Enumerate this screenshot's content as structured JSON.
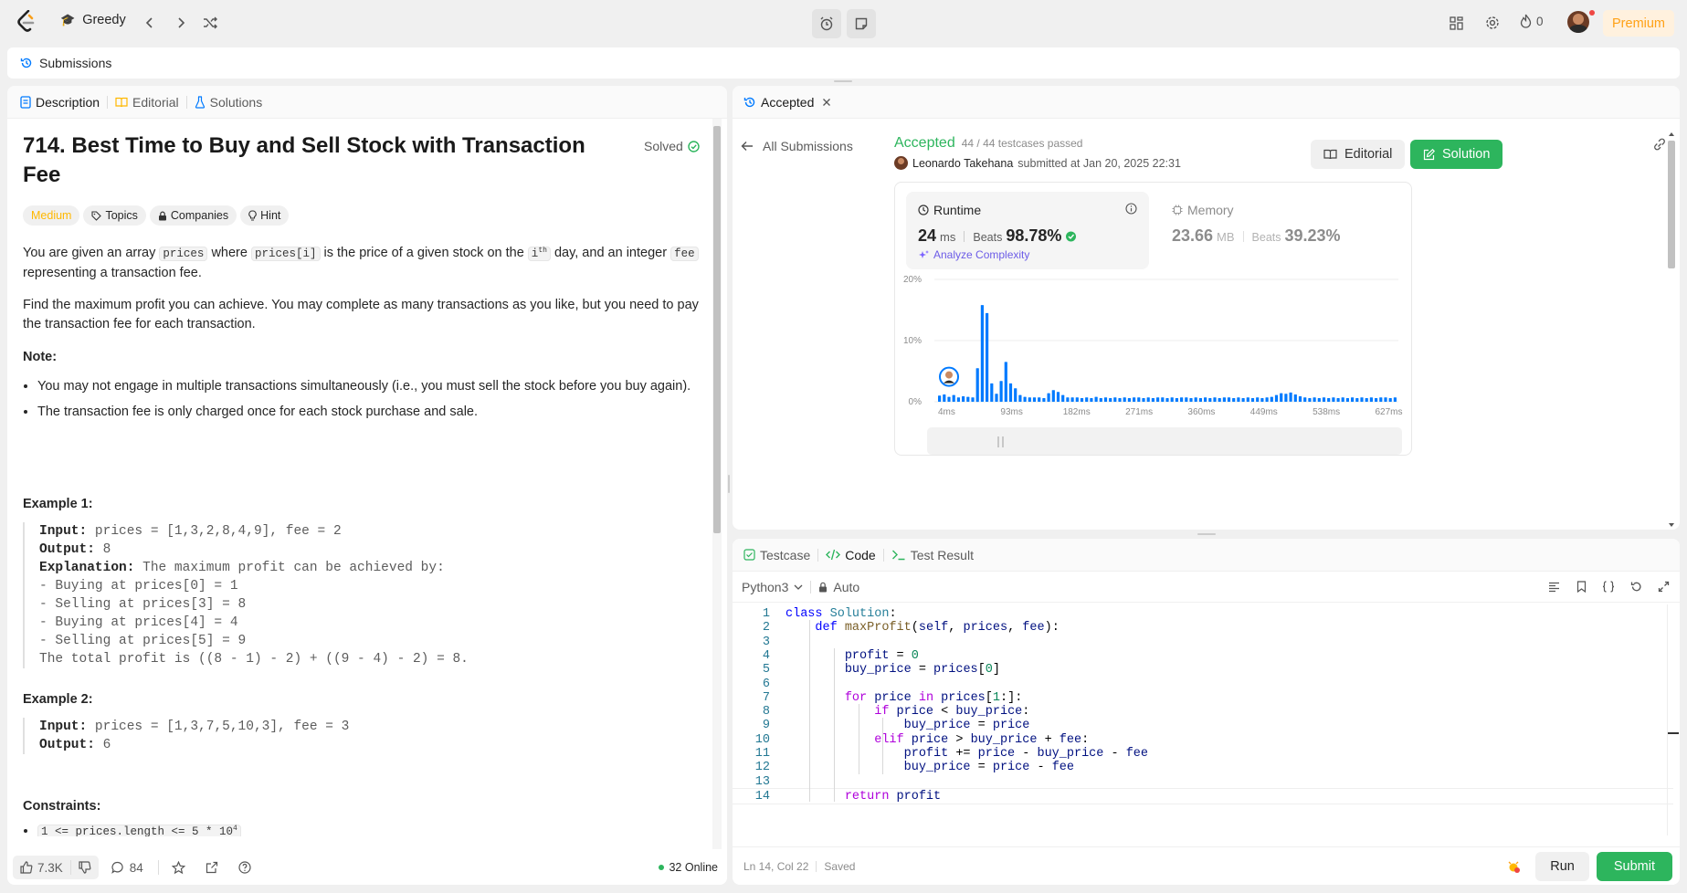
{
  "topbar": {
    "problem_list_label": "Greedy",
    "streak_count": "0",
    "premium_label": "Premium"
  },
  "subbar": {
    "label": "Submissions"
  },
  "left": {
    "tabs": [
      "Description",
      "Editorial",
      "Solutions"
    ],
    "title_line1": "714. Best Time to Buy and Sell Stock with Transaction",
    "title_line2": "Fee",
    "solved_label": "Solved",
    "chips": {
      "difficulty": "Medium",
      "topics": "Topics",
      "companies": "Companies",
      "hint": "Hint"
    },
    "para1": {
      "t1": "You are given an array ",
      "c1": "prices",
      "t2": " where ",
      "c2": "prices[i]",
      "t3": " is the price of a given stock on the ",
      "c3": "i",
      "c3sup": "th",
      "t4": " day, and an integer ",
      "c4": "fee",
      "t5": "representing a transaction fee."
    },
    "para2": "Find the maximum profit you can achieve. You may complete as many transactions as you like, but you need to pay the transaction fee for each transaction.",
    "note_label": "Note:",
    "notes": [
      "You may not engage in multiple transactions simultaneously (i.e., you must sell the stock before you buy again).",
      "The transaction fee is only charged once for each stock purchase and sale."
    ],
    "example1": {
      "heading": "Example 1:",
      "input_label": "Input:",
      "input": " prices = [1,3,2,8,4,9], fee = 2",
      "output_label": "Output:",
      "output": " 8",
      "explanation_label": "Explanation:",
      "explanation": " The maximum profit can be achieved by:",
      "steps": [
        "- Buying at prices[0] = 1",
        "- Selling at prices[3] = 8",
        "- Buying at prices[4] = 4",
        "- Selling at prices[5] = 9"
      ],
      "total": "The total profit is ((8 - 1) - 2) + ((9 - 4) - 2) = 8."
    },
    "example2": {
      "heading": "Example 2:",
      "input_label": "Input:",
      "input": " prices = [1,3,7,5,10,3], fee = 3",
      "output_label": "Output:",
      "output": " 6"
    },
    "constraints_label": "Constraints:",
    "constraint1": "1 <= prices.length <= 5 * 10",
    "constraint1_sup": "4",
    "footer": {
      "likes": "7.3K",
      "comments": "84",
      "online": "32 Online"
    }
  },
  "result": {
    "tab_label": "Accepted",
    "back_label": "All Submissions",
    "status": "Accepted",
    "testcases": "44 / 44 testcases passed",
    "user": "Leonardo Takehana",
    "submitted": "submitted at Jan 20, 2025 22:31",
    "editorial_btn": "Editorial",
    "solution_btn": "Solution",
    "runtime": {
      "label": "Runtime",
      "value": "24",
      "unit": "ms",
      "beats_label": "Beats",
      "beats": "98.78%",
      "analyze": "Analyze Complexity"
    },
    "memory": {
      "label": "Memory",
      "value": "23.66",
      "unit": "MB",
      "beats_label": "Beats",
      "beats": "39.23%"
    }
  },
  "chart_data": {
    "type": "bar",
    "title": "",
    "ylabel": "",
    "xlabel": "",
    "y_ticks": [
      "20%",
      "10%",
      "0%"
    ],
    "ylim": [
      0,
      20
    ],
    "x_tick_labels": [
      "4ms",
      "93ms",
      "182ms",
      "271ms",
      "360ms",
      "449ms",
      "538ms",
      "627ms"
    ],
    "values": [
      1.0,
      1.2,
      0.8,
      1.1,
      0.7,
      0.9,
      0.8,
      0.7,
      5.5,
      15.8,
      14.5,
      3.0,
      1.3,
      3.4,
      6.5,
      3.0,
      2.2,
      1.1,
      0.8,
      0.7,
      0.7,
      0.7,
      0.6,
      1.4,
      1.9,
      1.6,
      1.1,
      0.7,
      0.7,
      0.7,
      0.6,
      0.7,
      0.6,
      0.8,
      0.6,
      0.7,
      0.6,
      0.7,
      0.6,
      0.7,
      0.6,
      0.7,
      0.7,
      0.6,
      0.7,
      0.6,
      0.7,
      0.7,
      0.6,
      0.7,
      0.6,
      0.7,
      0.7,
      0.6,
      0.7,
      0.6,
      0.7,
      0.6,
      0.7,
      0.6,
      0.7,
      0.7,
      0.6,
      0.7,
      0.6,
      0.7,
      0.6,
      0.7,
      0.6,
      0.7,
      0.8,
      1.1,
      1.4,
      1.3,
      1.5,
      1.2,
      0.9,
      0.7,
      0.6,
      0.7,
      0.6,
      0.7,
      0.6,
      0.7,
      0.6,
      0.7,
      0.6,
      0.7,
      0.6,
      0.7,
      0.6,
      0.7,
      0.6,
      0.7,
      0.7,
      0.6,
      0.7
    ],
    "bar_color": "#007aff",
    "user_marker_index": 2
  },
  "editor": {
    "tabs": [
      "Testcase",
      "Code",
      "Test Result"
    ],
    "language": "Python3",
    "auto_label": "Auto",
    "lines": [
      "class Solution:",
      "    def maxProfit(self, prices, fee):",
      "",
      "        profit = 0",
      "        buy_price = prices[0]",
      "",
      "        for price in prices[1:]:",
      "            if price < buy_price:",
      "                buy_price = price",
      "            elif price > buy_price + fee:",
      "                profit += price - buy_price - fee",
      "                buy_price = price - fee",
      "",
      "        return profit"
    ],
    "status_pos": "Ln 14, Col 22",
    "status_saved": "Saved",
    "run_label": "Run",
    "submit_label": "Submit"
  },
  "colors": {
    "accent_green": "#2db55d",
    "accepted_green": "#2db55d",
    "premium_orange": "#ffa116",
    "medium_yellow": "#ffb800",
    "chart_blue": "#007aff"
  }
}
